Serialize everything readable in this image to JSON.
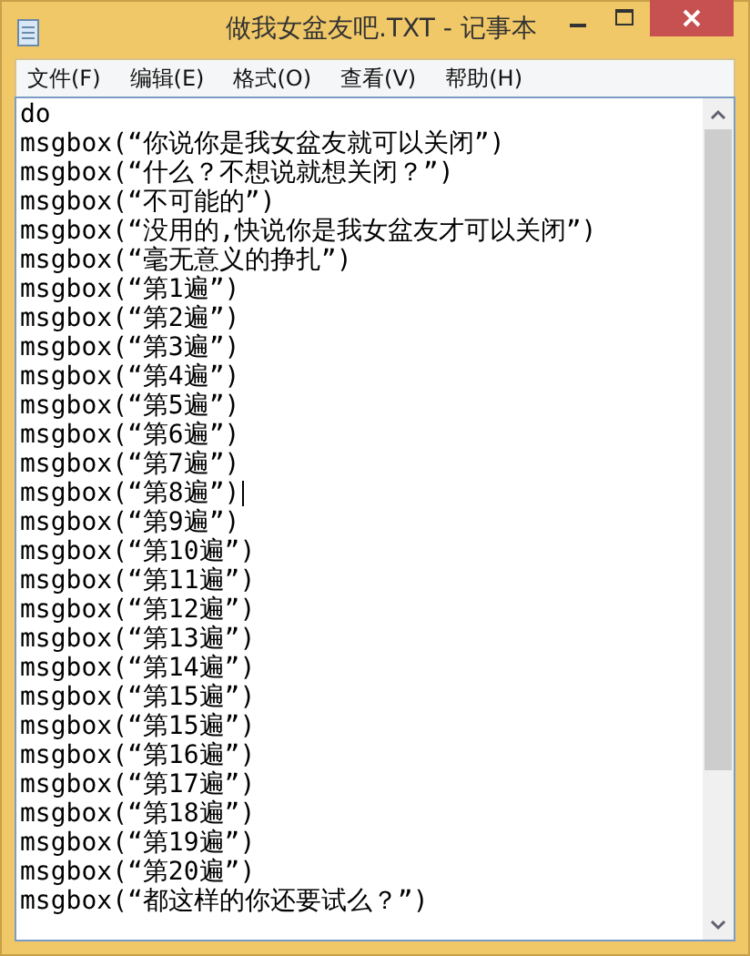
{
  "window": {
    "title": "做我女盆友吧.TXT - 记事本"
  },
  "menu": [
    "文件(F)",
    "编辑(E)",
    "格式(O)",
    "查看(V)",
    "帮助(H)"
  ],
  "editor": {
    "lines": [
      {
        "text": "do",
        "caret": false
      },
      {
        "text": "msgbox(“你说你是我女盆友就可以关闭”)",
        "caret": false
      },
      {
        "text": "msgbox(“什么？不想说就想关闭？”)",
        "caret": false
      },
      {
        "text": "msgbox(“不可能的”)",
        "caret": false
      },
      {
        "text": "msgbox(“没用的,快说你是我女盆友才可以关闭”)",
        "caret": false
      },
      {
        "text": "msgbox(“毫无意义的挣扎”)",
        "caret": false
      },
      {
        "text": "msgbox(“第1遍”)",
        "caret": false
      },
      {
        "text": "msgbox(“第2遍”)",
        "caret": false
      },
      {
        "text": "msgbox(“第3遍”)",
        "caret": false
      },
      {
        "text": "msgbox(“第4遍”)",
        "caret": false
      },
      {
        "text": "msgbox(“第5遍”)",
        "caret": false
      },
      {
        "text": "msgbox(“第6遍”)",
        "caret": false
      },
      {
        "text": "msgbox(“第7遍”)",
        "caret": false
      },
      {
        "text": "msgbox(“第8遍”)",
        "caret": true
      },
      {
        "text": "msgbox(“第9遍”)",
        "caret": false
      },
      {
        "text": "msgbox(“第10遍”)",
        "caret": false
      },
      {
        "text": "msgbox(“第11遍”)",
        "caret": false
      },
      {
        "text": "msgbox(“第12遍”)",
        "caret": false
      },
      {
        "text": "msgbox(“第13遍”)",
        "caret": false
      },
      {
        "text": "msgbox(“第14遍”)",
        "caret": false
      },
      {
        "text": "msgbox(“第15遍”)",
        "caret": false
      },
      {
        "text": "msgbox(“第15遍”)",
        "caret": false
      },
      {
        "text": "msgbox(“第16遍”)",
        "caret": false
      },
      {
        "text": "msgbox(“第17遍”)",
        "caret": false
      },
      {
        "text": "msgbox(“第18遍”)",
        "caret": false
      },
      {
        "text": "msgbox(“第19遍”)",
        "caret": false
      },
      {
        "text": "msgbox(“第20遍”)",
        "caret": false
      },
      {
        "text": "msgbox(“都这样的你还要试么？”)",
        "caret": false
      }
    ]
  }
}
